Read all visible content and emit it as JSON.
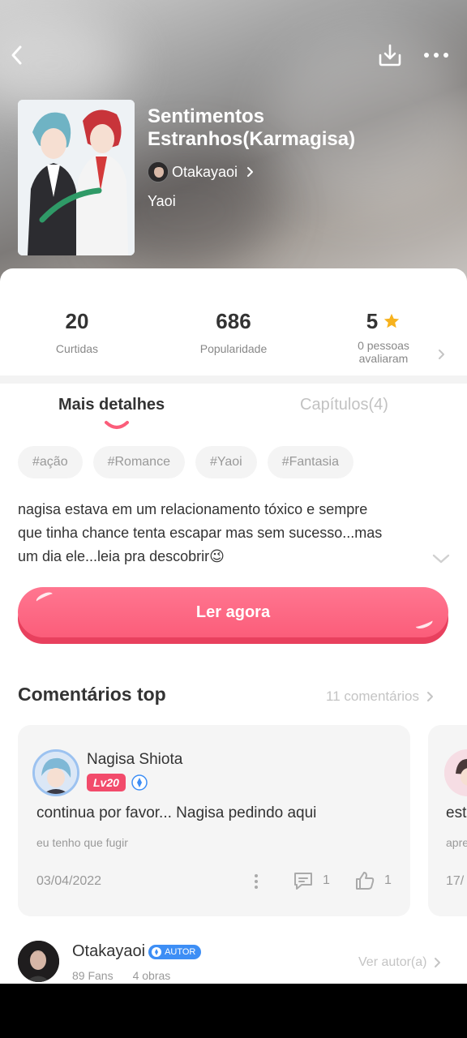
{
  "book": {
    "title_line1": "Sentimentos",
    "title_line2": "Estranhos(Karmagisa)",
    "author": "Otakayaoi",
    "genre": "Yaoi"
  },
  "stats": {
    "likes_value": "20",
    "likes_label": "Curtidas",
    "popularity_value": "686",
    "popularity_label": "Popularidade",
    "rating_value": "5",
    "rating_label_line1": "0 pessoas",
    "rating_label_line2": "avaliaram"
  },
  "tabs": {
    "details": "Mais detalhes",
    "chapters": "Capítulos(4)"
  },
  "tags": [
    "#ação",
    "#Romance",
    "#Yaoi",
    "#Fantasia"
  ],
  "synopsis": {
    "line1": "nagisa estava em um relacionamento tóxico e sempre",
    "line2": "que tinha chance tenta escapar mas sem sucesso...mas",
    "line3": "um dia ele...leia pra descobrir😉"
  },
  "read_button": "Ler agora",
  "comments": {
    "section_title": "Comentários top",
    "count_label": "11 comentários",
    "items": [
      {
        "user": "Nagisa Shiota",
        "level": "Lv20",
        "text": "continua por favor... Nagisa pedindo aqui",
        "sub": "eu tenho que fugir",
        "date": "03/04/2022",
        "replies": "1",
        "likes": "1"
      },
      {
        "text": "est",
        "sub": "apre",
        "date": "17/"
      }
    ]
  },
  "author_card": {
    "name": "Otakayaoi",
    "badge": "AUTOR",
    "fans": "89 Fans",
    "works": "4 obras",
    "view_label": "Ver autor(a)"
  },
  "colors": {
    "accent": "#fb5d7a",
    "star": "#f7b21d",
    "verified": "#3d8ef5"
  },
  "icons": [
    "back-icon",
    "download-icon",
    "more-icon",
    "chevron-right-icon",
    "star-icon",
    "chevron-down-icon",
    "verified-icon",
    "comment-icon",
    "thumbs-up-icon"
  ]
}
